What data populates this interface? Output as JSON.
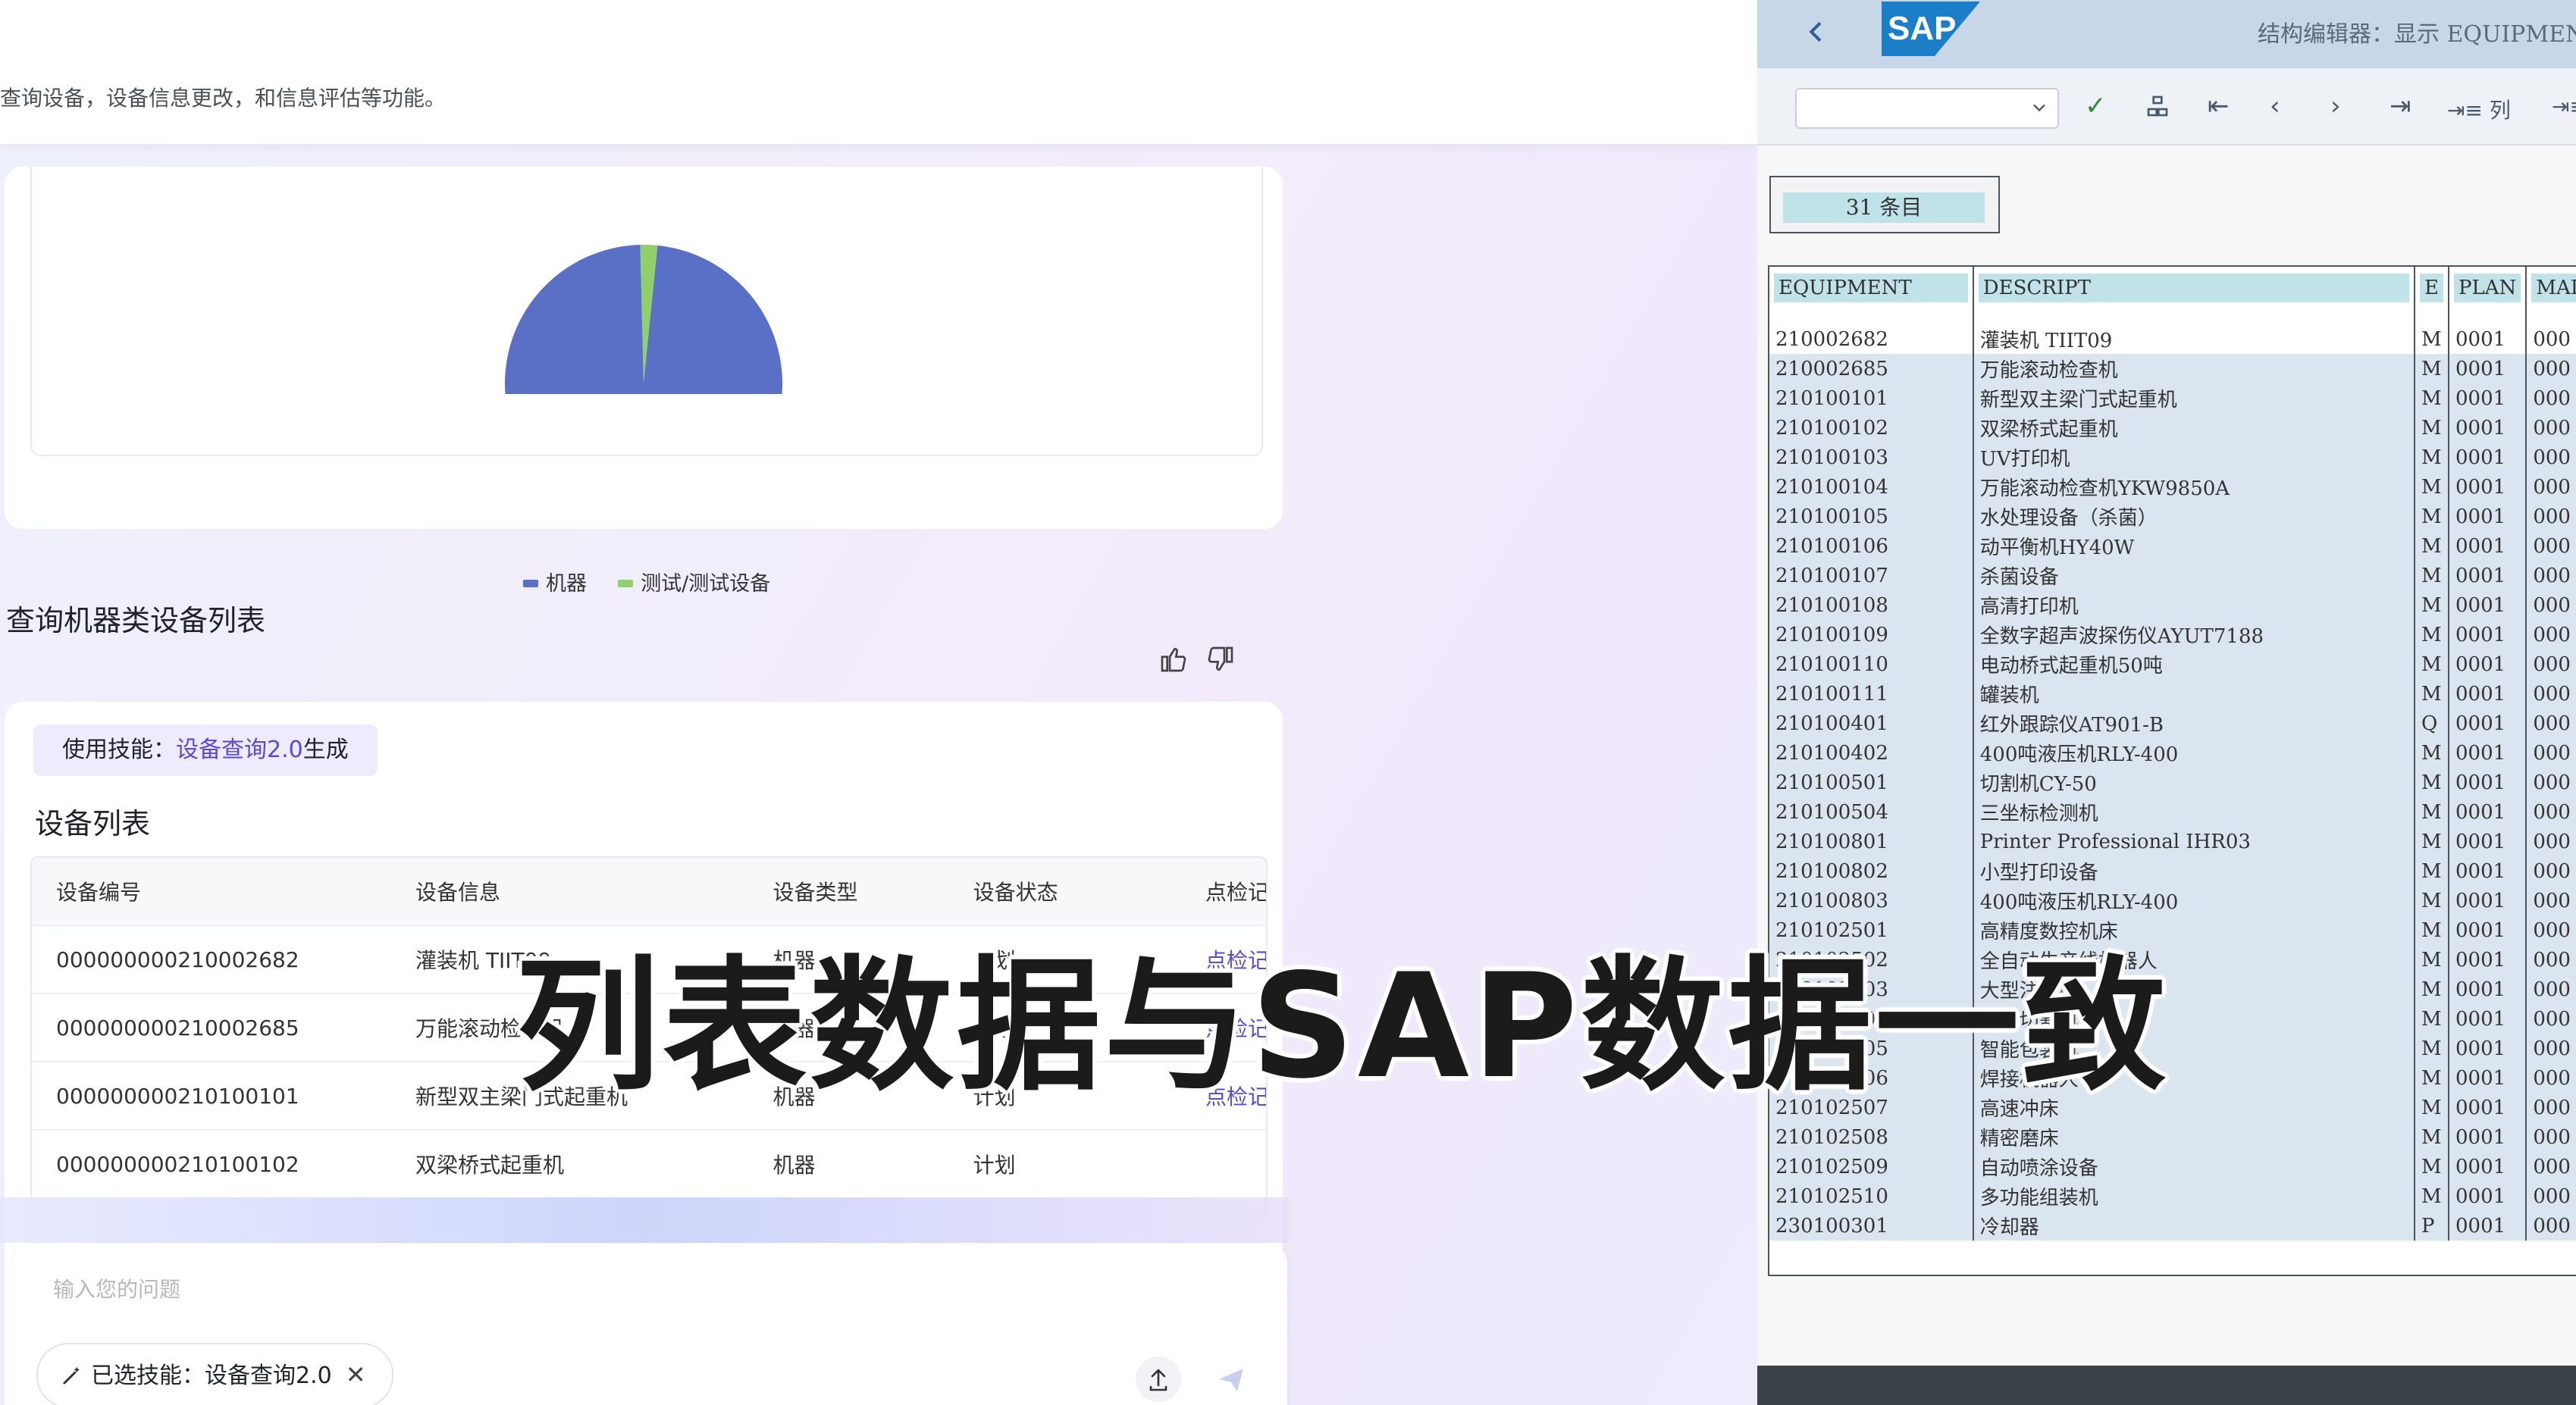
{
  "header": {
    "description": "查询设备，设备信息更改，和信息评估等功能。"
  },
  "chart_data": {
    "type": "pie",
    "categories": [
      "机器",
      "测试/测试设备"
    ],
    "values": [
      98,
      2
    ],
    "colors": [
      "#5a6fc6",
      "#8fd06a"
    ],
    "slice_label": "机器",
    "legend": [
      "机器",
      "测试/测试设备"
    ],
    "legend_position": "bottom"
  },
  "query": {
    "title": "查询机器类设备列表"
  },
  "list_card": {
    "skill_prefix": "使用技能：",
    "skill_name": "设备查询2.0",
    "skill_suffix": "生成",
    "title": "设备列表",
    "columns": [
      "设备编号",
      "设备信息",
      "设备类型",
      "设备状态",
      "点检记录"
    ],
    "rows": [
      {
        "id": "000000000210002682",
        "info": "灌装机 TIIT09",
        "type": "机器",
        "status": "计划",
        "link": "点检记录"
      },
      {
        "id": "000000000210002685",
        "info": "万能滚动检查机",
        "type": "机器",
        "status": "计划",
        "link": "点检记录"
      },
      {
        "id": "000000000210100101",
        "info": "新型双主梁门式起重机",
        "type": "机器",
        "status": "计划",
        "link": "点检记录"
      },
      {
        "id": "000000000210100102",
        "info": "双梁桥式起重机",
        "type": "机器",
        "status": "计划",
        "link": ""
      }
    ]
  },
  "input": {
    "placeholder": "输入您的问题",
    "chip_label": "已选技能：设备查询2.0",
    "chip_close": "✕"
  },
  "sap": {
    "logo": "SAP",
    "title": "结构编辑器：显示 EQUIPMENT",
    "toolbar": {
      "columns_label": "列"
    },
    "count": "31 条目",
    "columns": [
      "EQUIPMENT",
      "DESCRIPT",
      "E",
      "PLAN",
      "MAI"
    ],
    "rows": [
      [
        "210002682",
        "灌装机 TIIT09",
        "M",
        "0001",
        "000"
      ],
      [
        "210002685",
        "万能滚动检查机",
        "M",
        "0001",
        "000"
      ],
      [
        "210100101",
        "新型双主梁门式起重机",
        "M",
        "0001",
        "000"
      ],
      [
        "210100102",
        "双梁桥式起重机",
        "M",
        "0001",
        "000"
      ],
      [
        "210100103",
        "UV打印机",
        "M",
        "0001",
        "000"
      ],
      [
        "210100104",
        "万能滚动检查机YKW9850A",
        "M",
        "0001",
        "000"
      ],
      [
        "210100105",
        "水处理设备（杀菌）",
        "M",
        "0001",
        "000"
      ],
      [
        "210100106",
        "动平衡机HY40W",
        "M",
        "0001",
        "000"
      ],
      [
        "210100107",
        "杀菌设备",
        "M",
        "0001",
        "000"
      ],
      [
        "210100108",
        "高清打印机",
        "M",
        "0001",
        "000"
      ],
      [
        "210100109",
        "全数字超声波探伤仪AYUT7188",
        "M",
        "0001",
        "000"
      ],
      [
        "210100110",
        "电动桥式起重机50吨",
        "M",
        "0001",
        "000"
      ],
      [
        "210100111",
        "罐装机",
        "M",
        "0001",
        "000"
      ],
      [
        "210100401",
        "红外跟踪仪AT901-B",
        "Q",
        "0001",
        "000"
      ],
      [
        "210100402",
        "400吨液压机RLY-400",
        "M",
        "0001",
        "000"
      ],
      [
        "210100501",
        "切割机CY-50",
        "M",
        "0001",
        "000"
      ],
      [
        "210100504",
        "三坐标检测机",
        "M",
        "0001",
        "000"
      ],
      [
        "210100801",
        "Printer Professional IHR03",
        "M",
        "0001",
        "000"
      ],
      [
        "210100802",
        "小型打印设备",
        "M",
        "0001",
        "000"
      ],
      [
        "210100803",
        "400吨液压机RLY-400",
        "M",
        "0001",
        "000"
      ],
      [
        "210102501",
        "高精度数控机床",
        "M",
        "0001",
        "000"
      ],
      [
        "210102502",
        "全自动生产线机器人",
        "M",
        "0001",
        "000"
      ],
      [
        "210102503",
        "大型注塑机",
        "M",
        "0001",
        "000"
      ],
      [
        "210102504",
        "激光切割机",
        "M",
        "0001",
        "000"
      ],
      [
        "210102505",
        "智能包装机",
        "M",
        "0001",
        "000"
      ],
      [
        "210102506",
        "焊接机器人",
        "M",
        "0001",
        "000"
      ],
      [
        "210102507",
        "高速冲床",
        "M",
        "0001",
        "000"
      ],
      [
        "210102508",
        "精密磨床",
        "M",
        "0001",
        "000"
      ],
      [
        "210102509",
        "自动喷涂设备",
        "M",
        "0001",
        "000"
      ],
      [
        "210102510",
        "多功能组装机",
        "M",
        "0001",
        "000"
      ],
      [
        "230100301",
        "冷却器",
        "P",
        "0001",
        "000"
      ]
    ]
  },
  "caption": "列表数据与SAP数据一致"
}
